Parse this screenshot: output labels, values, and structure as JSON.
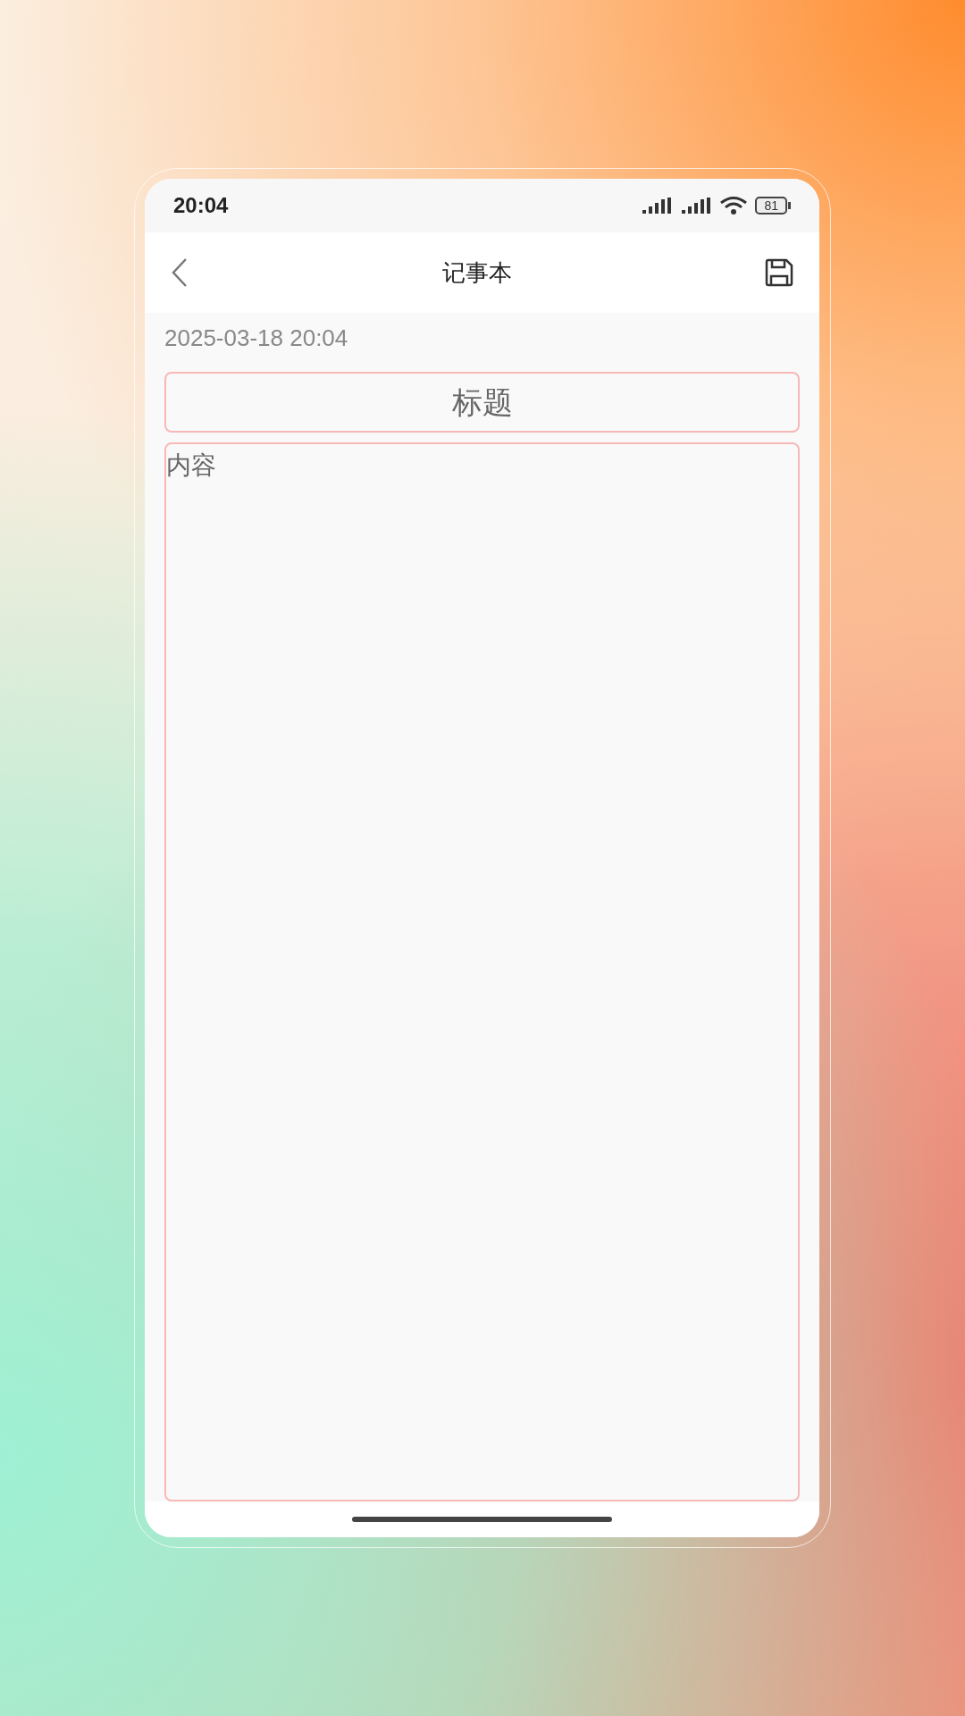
{
  "status_bar": {
    "time": "20:04",
    "battery": "81"
  },
  "header": {
    "title": "记事本"
  },
  "date": "2025-03-18 20:04",
  "title_field": {
    "placeholder": "标题"
  },
  "content_field": {
    "placeholder": "内容"
  }
}
